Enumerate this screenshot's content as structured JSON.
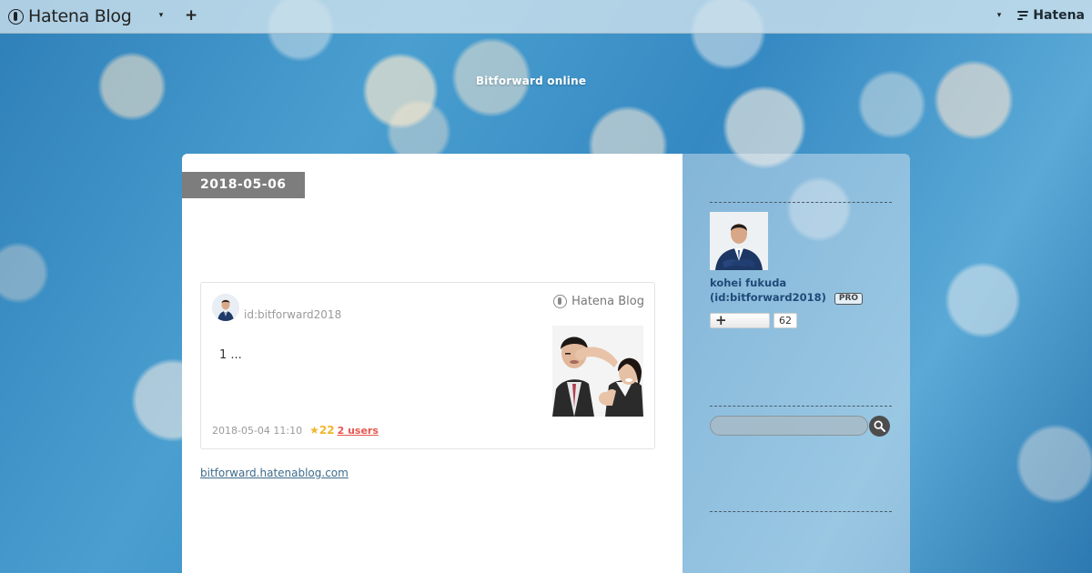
{
  "global_header": {
    "logo_text": "Hatena Blog",
    "logo_icon": "hatena-blog-logo-icon",
    "menu_caret": "▾",
    "add_icon": "+",
    "user_caret": "▾",
    "hatena_label": "Hatena"
  },
  "blog": {
    "title": "Bitforward online"
  },
  "entry": {
    "date": "2018-05-06",
    "embed": {
      "user_id": "id:bitforward2018",
      "brand": "Hatena Blog",
      "excerpt": "1 ...",
      "timestamp": "2018-05-04 11:10",
      "star_icon": "★",
      "star_count": "22",
      "bookmark_users": "2 users"
    },
    "link_text": "bitforward.hatenablog.com"
  },
  "sidebar": {
    "profile_name": "kohei fukuda",
    "profile_id": "(id:bitforward2018)",
    "pro_badge": "PRO",
    "follow_icon": "+",
    "follower_count": "62",
    "search_placeholder": "",
    "search_icon": "search-icon"
  },
  "colors": {
    "header_bg": "#d2e4ee",
    "date_tab_bg": "#7d7d7d",
    "profile_name": "#1f4a78",
    "bookmark_users": "#e8554e",
    "star": "#f0b62e",
    "link": "#3d6b8a"
  }
}
